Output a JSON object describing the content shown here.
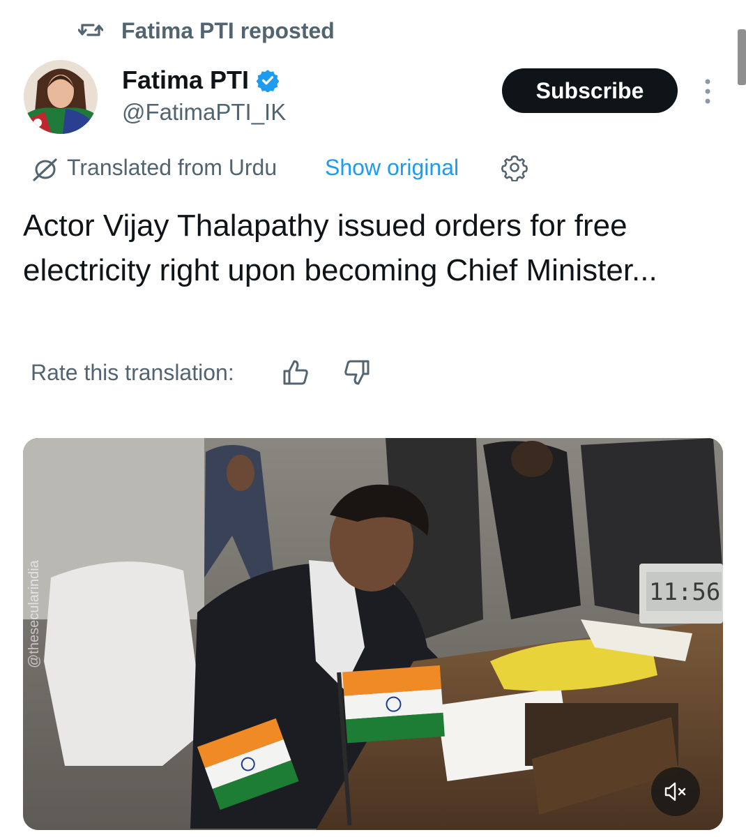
{
  "repost": {
    "text": "Fatima PTI reposted",
    "icon": "repost-icon"
  },
  "author": {
    "name": "Fatima PTI",
    "handle": "@FatimaPTI_IK",
    "verified": true,
    "verified_color": "#1d9bf0"
  },
  "header": {
    "subscribe_label": "Subscribe",
    "more_icon": "more-vertical-icon"
  },
  "translation": {
    "label": "Translated from Urdu",
    "show_original": "Show original",
    "link_color": "#1d9bf0",
    "settings_icon": "settings-icon"
  },
  "tweet": {
    "text": "Actor Vijay Thalapathy issued orders for free electricity right upon becoming Chief Minister..."
  },
  "rating": {
    "label": "Rate this translation:",
    "up_icon": "thumb-up-icon",
    "down_icon": "thumb-down-icon"
  },
  "media": {
    "type": "video",
    "clock_time": "11:56",
    "watermark": "@thesecularindia",
    "mute_icon": "volume-mute-icon"
  }
}
